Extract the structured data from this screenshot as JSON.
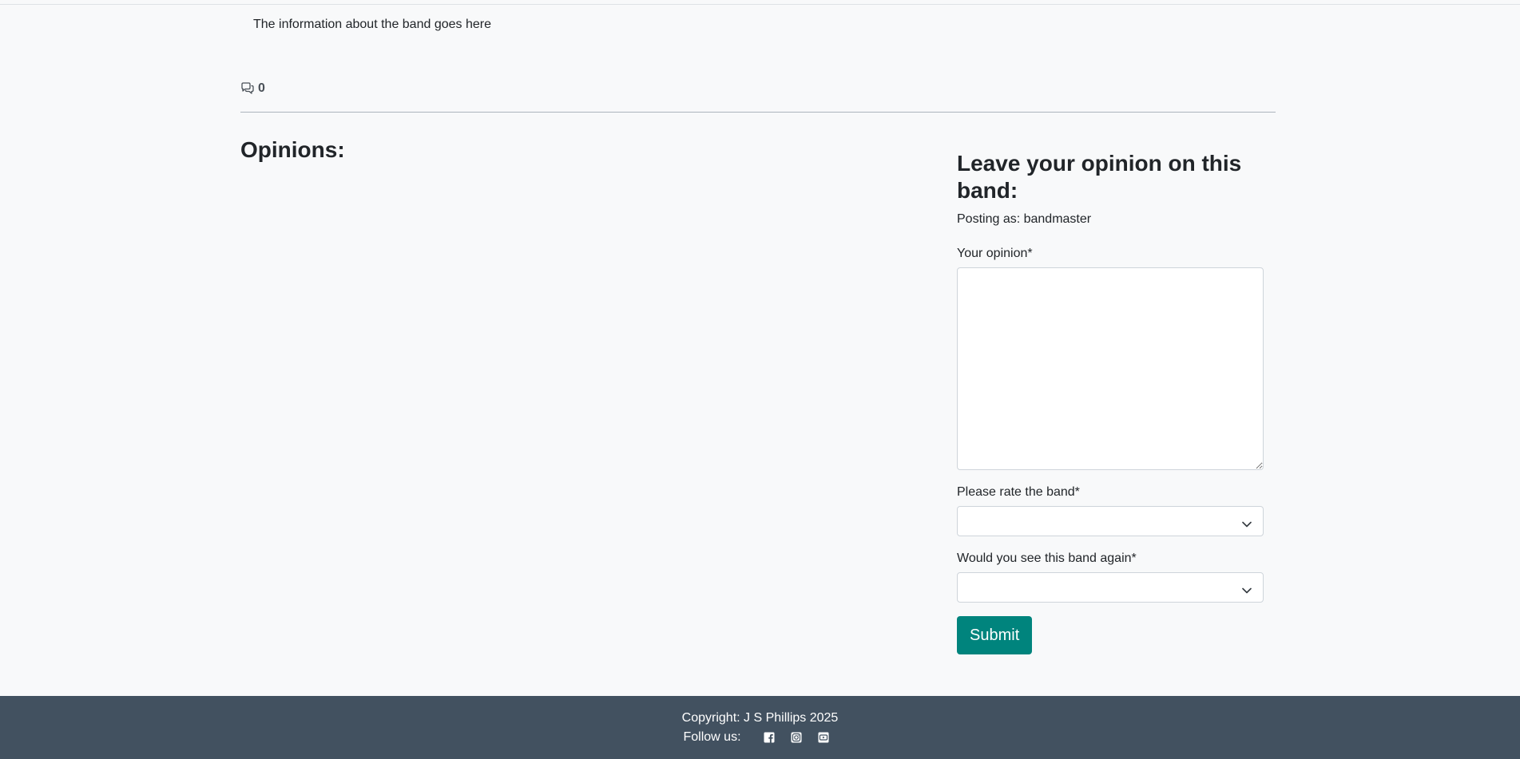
{
  "band": {
    "info": "The information about the band goes here"
  },
  "comments": {
    "count": "0",
    "icon": "chat-bubbles-icon"
  },
  "opinions": {
    "title": "Opinions:"
  },
  "form": {
    "title": "Leave your opinion on this band:",
    "posting_as": "Posting as: bandmaster",
    "opinion_label": "Your opinion*",
    "opinion_value": "",
    "rate_label": "Please rate the band*",
    "rate_value": "",
    "again_label": "Would you see this band again*",
    "again_value": "",
    "submit_label": "Submit"
  },
  "footer": {
    "copyright": "Copyright: J S Phillips 2025",
    "follow_label": "Follow us:",
    "social_icons": [
      "facebook-icon",
      "instagram-icon",
      "youtube-icon"
    ]
  },
  "colors": {
    "accent": "#00847d",
    "footer_bg": "#425160",
    "page_bg": "#f8f9fa"
  }
}
